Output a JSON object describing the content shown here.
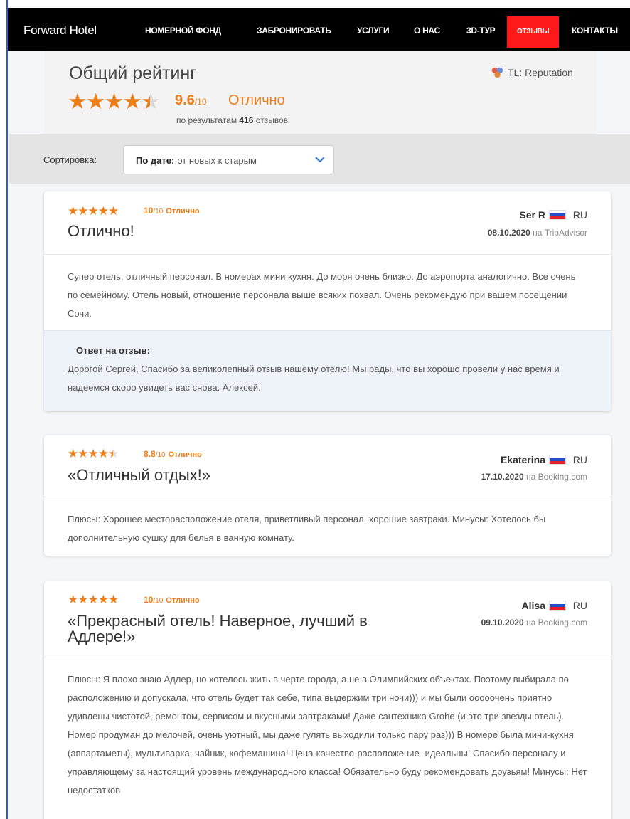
{
  "nav": {
    "logo": "Forward Hotel",
    "items": [
      {
        "label": "НОМЕРНОЙ ФОНД"
      },
      {
        "label": "ЗАБРОНИРОВАТЬ"
      },
      {
        "label": "УСЛУГИ"
      },
      {
        "label": "О НАС"
      },
      {
        "label": "3D-ТУР"
      },
      {
        "label": "ОТЗЫВЫ"
      },
      {
        "label": "КОНТАКТЫ"
      }
    ],
    "active_index": 5,
    "active_color": "#ff1a1a"
  },
  "rating": {
    "title": "Общий рейтинг",
    "provider": "TL: Reputation",
    "stars": 4.5,
    "score": "9.6",
    "score_max": "/10",
    "verdict": "Отлично",
    "by_prefix": "по результатам",
    "count": "416",
    "by_suffix": "отзывов"
  },
  "sort": {
    "label": "Сортировка:",
    "key": "По дате:",
    "value": "от новых к старым"
  },
  "reviews": [
    {
      "stars": 5,
      "score": "10",
      "score_max": "/10",
      "verdict": "Отлично",
      "title": "Отлично!",
      "author": "Ser R",
      "lang": "RU",
      "date": "08.10.2020",
      "source": "на TripAdvisor",
      "text": "Супер отель, отличный персонал. В номерах мини кухня. До моря очень близко. До аэропорта аналогично. Все очень по семейному. Отель новый, отношение персонала выше всяких похвал. Очень рекомендую при вашем посещении Сочи.",
      "reply_label": "Ответ на отзыв:",
      "reply": "Дорогой Сергей, Спасибо за великолепный отзыв нашему отелю! Мы рады, что вы хорошо провели у нас время и надеемся скоро увидеть вас снова. Алексей."
    },
    {
      "stars": 4.5,
      "score": "8.8",
      "score_max": "/10",
      "verdict": "Отлично",
      "title": "«Отличный отдых!»",
      "author": "Ekaterina",
      "lang": "RU",
      "date": "17.10.2020",
      "source": "на Booking.com",
      "text": "Плюсы: Хорошее месторасположение отеля, приветливый персонал, хорошие завтраки. Минусы: Хотелось бы дополнительную сушку для белья в ванную комнату."
    },
    {
      "stars": 5,
      "score": "10",
      "score_max": "/10",
      "verdict": "Отлично",
      "title": "«Прекрасный отель! Наверное, лучший в Адлере!»",
      "author": "Alisa",
      "lang": "RU",
      "date": "09.10.2020",
      "source": "на Booking.com",
      "text": "Плюсы: Я плохо знаю Адлер, но хотелось жить в черте города, а не в Олимпийских объектах. Поэтому выбирала по расположению и допускала, что отель будет так себе, типа выдержим три ночи))) и мы были ооооочень приятно удивлены чистотой, ремонтом, сервисом и вкусными завтраками! Даже сантехника Grohe (и это три звезды отель). Номер продуман до мелочей, очень уютный, мы даже гулять выходили только пару раз))) В номере была мини-кухня (аппартаметы), мультиварка, чайник, кофемашина! Цена-качество-расположение- идеальны! Спасибо персоналу и управляющему за настоящий уровень международного класса! Обязательно буду рекомендовать друзьям! Минусы: Нет недостатков"
    }
  ]
}
